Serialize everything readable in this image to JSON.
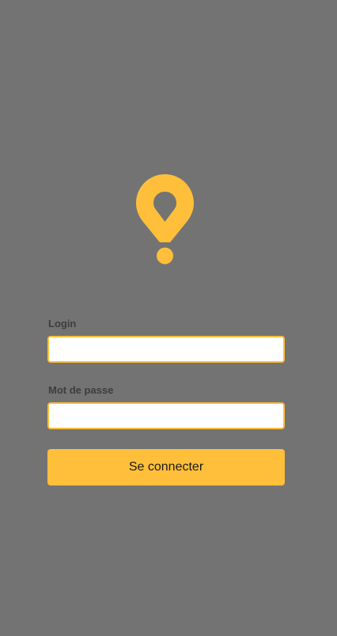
{
  "brand": {
    "logo_icon": "map-pin-icon",
    "accent_color": "#ffbf3b",
    "background_color": "#737373"
  },
  "login_form": {
    "login_label": "Login",
    "login_value": "",
    "password_label": "Mot de passe",
    "password_value": "",
    "submit_label": "Se connecter"
  }
}
